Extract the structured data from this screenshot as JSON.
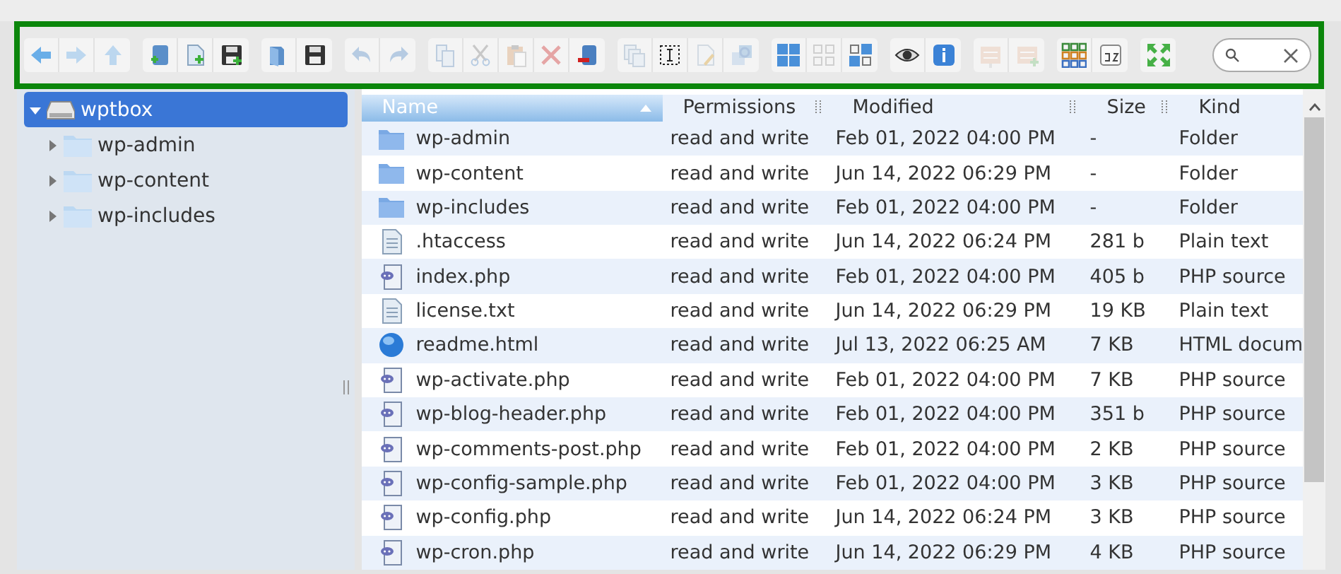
{
  "toolbar": {
    "groups": [
      [
        {
          "kind": "back",
          "disabled": false
        },
        {
          "kind": "forward",
          "disabled": true
        },
        {
          "kind": "up",
          "disabled": true
        }
      ],
      [
        {
          "kind": "newfolder",
          "disabled": false
        },
        {
          "kind": "newfile",
          "disabled": false
        },
        {
          "kind": "upload",
          "disabled": false
        }
      ],
      [
        {
          "kind": "open",
          "disabled": false
        },
        {
          "kind": "download",
          "disabled": false
        }
      ],
      [
        {
          "kind": "undo",
          "disabled": true
        },
        {
          "kind": "redo",
          "disabled": true
        }
      ],
      [
        {
          "kind": "copy",
          "disabled": true
        },
        {
          "kind": "cut",
          "disabled": true
        },
        {
          "kind": "paste",
          "disabled": true
        },
        {
          "kind": "delete",
          "disabled": true
        },
        {
          "kind": "trash",
          "disabled": false
        }
      ],
      [
        {
          "kind": "duplicate",
          "disabled": true
        },
        {
          "kind": "rename",
          "disabled": false
        },
        {
          "kind": "edit",
          "disabled": true
        },
        {
          "kind": "resize",
          "disabled": true
        }
      ],
      [
        {
          "kind": "selectall",
          "disabled": false
        },
        {
          "kind": "selectnone",
          "disabled": true
        },
        {
          "kind": "invert",
          "disabled": false
        }
      ],
      [
        {
          "kind": "preview",
          "disabled": false
        },
        {
          "kind": "info",
          "disabled": false
        }
      ],
      [
        {
          "kind": "archive",
          "disabled": true
        },
        {
          "kind": "extract",
          "disabled": true
        }
      ],
      [
        {
          "kind": "view",
          "disabled": false
        },
        {
          "kind": "sort",
          "disabled": false
        }
      ],
      [
        {
          "kind": "fullscreen",
          "disabled": false
        }
      ]
    ]
  },
  "sidebar": {
    "root": {
      "label": "wptbox",
      "expanded": true,
      "selected": true,
      "children": [
        {
          "label": "wp-admin",
          "expanded": false,
          "selected": false
        },
        {
          "label": "wp-content",
          "expanded": false,
          "selected": false
        },
        {
          "label": "wp-includes",
          "expanded": false,
          "selected": false
        }
      ]
    }
  },
  "table": {
    "columns": [
      {
        "label": "Name",
        "sorted": true
      },
      {
        "label": "Permissions",
        "sorted": false
      },
      {
        "label": "Modified",
        "sorted": false
      },
      {
        "label": "Size",
        "sorted": false
      },
      {
        "label": "Kind",
        "sorted": false
      }
    ],
    "rows": [
      {
        "kind": "folder",
        "name": "wp-admin",
        "permissions": "read and write",
        "modified": "Feb 01, 2022 04:00 PM",
        "size": "-",
        "type": "Folder"
      },
      {
        "kind": "folder",
        "name": "wp-content",
        "permissions": "read and write",
        "modified": "Jun 14, 2022 06:29 PM",
        "size": "-",
        "type": "Folder"
      },
      {
        "kind": "folder",
        "name": "wp-includes",
        "permissions": "read and write",
        "modified": "Feb 01, 2022 04:00 PM",
        "size": "-",
        "type": "Folder"
      },
      {
        "kind": "text",
        "name": ".htaccess",
        "permissions": "read and write",
        "modified": "Jun 14, 2022 06:24 PM",
        "size": "281 b",
        "type": "Plain text"
      },
      {
        "kind": "php",
        "name": "index.php",
        "permissions": "read and write",
        "modified": "Feb 01, 2022 04:00 PM",
        "size": "405 b",
        "type": "PHP source"
      },
      {
        "kind": "text",
        "name": "license.txt",
        "permissions": "read and write",
        "modified": "Jun 14, 2022 06:29 PM",
        "size": "19 KB",
        "type": "Plain text"
      },
      {
        "kind": "html",
        "name": "readme.html",
        "permissions": "read and write",
        "modified": "Jul 13, 2022 06:25 AM",
        "size": "7 KB",
        "type": "HTML docum"
      },
      {
        "kind": "php",
        "name": "wp-activate.php",
        "permissions": "read and write",
        "modified": "Feb 01, 2022 04:00 PM",
        "size": "7 KB",
        "type": "PHP source"
      },
      {
        "kind": "php",
        "name": "wp-blog-header.php",
        "permissions": "read and write",
        "modified": "Feb 01, 2022 04:00 PM",
        "size": "351 b",
        "type": "PHP source"
      },
      {
        "kind": "php",
        "name": "wp-comments-post.php",
        "permissions": "read and write",
        "modified": "Feb 01, 2022 04:00 PM",
        "size": "2 KB",
        "type": "PHP source"
      },
      {
        "kind": "php",
        "name": "wp-config-sample.php",
        "permissions": "read and write",
        "modified": "Feb 01, 2022 04:00 PM",
        "size": "3 KB",
        "type": "PHP source"
      },
      {
        "kind": "php",
        "name": "wp-config.php",
        "permissions": "read and write",
        "modified": "Jun 14, 2022 06:24 PM",
        "size": "3 KB",
        "type": "PHP source"
      },
      {
        "kind": "php",
        "name": "wp-cron.php",
        "permissions": "read and write",
        "modified": "Jun 14, 2022 06:29 PM",
        "size": "4 KB",
        "type": "PHP source"
      }
    ]
  }
}
